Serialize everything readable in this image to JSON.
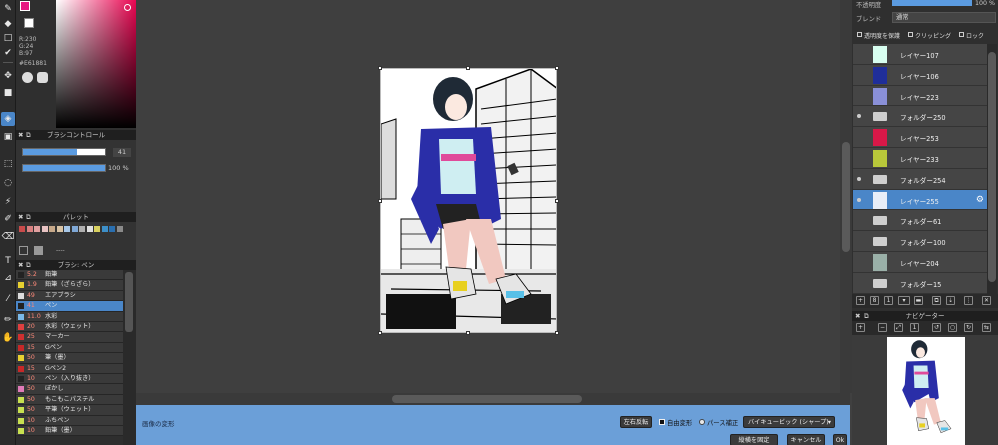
{
  "color_panel": {
    "main_color": "#e61881",
    "r_label": "R:230",
    "g_label": "G:24",
    "b_label": "B:97",
    "hex_label": "#E61881"
  },
  "brush_control": {
    "title": "ブラシコントロール",
    "size_value": "41",
    "opacity_value": "100 %"
  },
  "palette": {
    "title": "パレット",
    "dash": "----",
    "chips": [
      "#c94b4b",
      "#d98080",
      "#e0a0a0",
      "#e8c3c3",
      "#c7a98a",
      "#d8c3a5",
      "#a7c7e7",
      "#7fa8d6",
      "#b0b0b0",
      "#e0e0e0",
      "#d8d060",
      "#3d8fc8",
      "#2a6fb0",
      "#8a8a8a"
    ]
  },
  "brush_panel": {
    "title": "ブラシ: ペン",
    "items": [
      {
        "size": "5.2",
        "name": "鉛筆",
        "color": "#222222"
      },
      {
        "size": "1.9",
        "name": "鉛筆（ざらざら）",
        "color": "#e8d030"
      },
      {
        "size": "49",
        "name": "エアブラシ",
        "color": "#dddddd"
      },
      {
        "size": "41",
        "name": "ペン",
        "color": "#222222"
      },
      {
        "size": "11.0",
        "name": "水彩",
        "color": "#7ab8e8"
      },
      {
        "size": "20",
        "name": "水彩（ウェット）",
        "color": "#e04040"
      },
      {
        "size": "25",
        "name": "マーカー",
        "color": "#d03030"
      },
      {
        "size": "15",
        "name": "Gペン",
        "color": "#c82828"
      },
      {
        "size": "50",
        "name": "筆（墨）",
        "color": "#e8d030"
      },
      {
        "size": "15",
        "name": "Gペン2",
        "color": "#c82828"
      },
      {
        "size": "10",
        "name": "ペン（入り抜き）",
        "color": "#222222"
      },
      {
        "size": "50",
        "name": "ぼかし",
        "color": "#e07ab8"
      },
      {
        "size": "50",
        "name": "もこもこパステル",
        "color": "#c8e050"
      },
      {
        "size": "50",
        "name": "平筆（ウェット）",
        "color": "#c8e050"
      },
      {
        "size": "10",
        "name": "ふちペン",
        "color": "#c8e050"
      },
      {
        "size": "10",
        "name": "鉛筆（墨）",
        "color": "#c8e050"
      }
    ]
  },
  "layer_panel": {
    "opacity_label": "不透明度",
    "opacity_value": "100 %",
    "blend_label": "ブレンド",
    "blend_value": "通常",
    "protect_label": "透明度を保護",
    "clipping_label": "クリッピング",
    "lock_label": "ロック",
    "layers": [
      {
        "name": "レイヤー107",
        "kind": "layer",
        "thumb": "#d8fff0",
        "visible": false,
        "selected": false
      },
      {
        "name": "レイヤー106",
        "kind": "layer",
        "thumb": "#1f2e9a",
        "visible": false,
        "selected": false
      },
      {
        "name": "レイヤー223",
        "kind": "layer",
        "thumb": "#8a90d8",
        "visible": false,
        "selected": false
      },
      {
        "name": "フォルダー250",
        "kind": "folder",
        "visible": true,
        "selected": false
      },
      {
        "name": "レイヤー253",
        "kind": "layer",
        "thumb": "#d81848",
        "visible": false,
        "selected": false
      },
      {
        "name": "レイヤー233",
        "kind": "layer",
        "thumb": "#b8c83a",
        "visible": false,
        "selected": false
      },
      {
        "name": "フォルダー254",
        "kind": "folder",
        "visible": true,
        "selected": false
      },
      {
        "name": "レイヤー255",
        "kind": "layer",
        "thumb": "#e8eef8",
        "visible": true,
        "selected": true
      },
      {
        "name": "フォルダー61",
        "kind": "folder",
        "visible": false,
        "selected": false
      },
      {
        "name": "フォルダー100",
        "kind": "folder",
        "visible": false,
        "selected": false
      },
      {
        "name": "レイヤー204",
        "kind": "layer",
        "thumb": "#9ab0a8",
        "visible": false,
        "selected": false
      },
      {
        "name": "フォルダー15",
        "kind": "folder",
        "visible": false,
        "selected": false
      }
    ]
  },
  "navigator": {
    "title": "ナビゲーター"
  },
  "transform_bar": {
    "title": "画像の変形",
    "flip_button": "左右反転",
    "free_transform_label": "自由変形",
    "perspective_label": "パース補正",
    "interpolation_value": "バイキュービック (シャープ)",
    "mode_button": "縦横を固定",
    "cancel_button": "キャンセル",
    "ok_button": "Ok"
  }
}
